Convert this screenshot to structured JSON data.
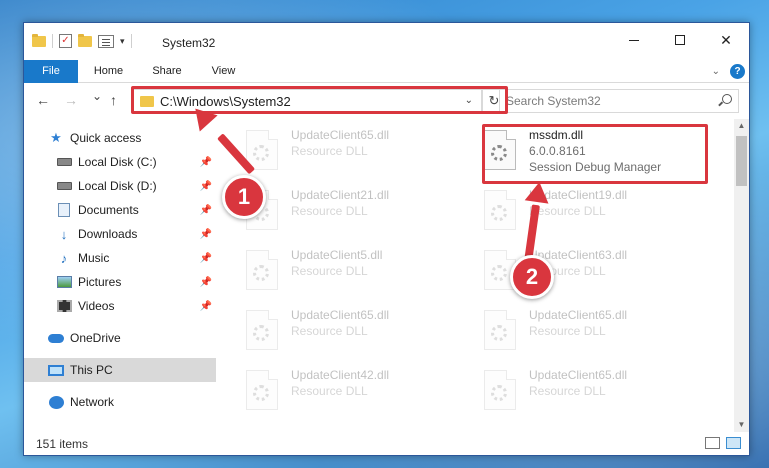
{
  "window": {
    "title": "System32"
  },
  "ribbon": {
    "tabs": [
      "File",
      "Home",
      "Share",
      "View"
    ],
    "help": "?"
  },
  "nav": {
    "back": "←",
    "forward": "→",
    "recent": "⌄",
    "up": "↑",
    "address": "C:\\Windows\\System32",
    "search_placeholder": "Search System32"
  },
  "sidebar": {
    "items": [
      {
        "label": "Quick access",
        "icon": "star-icon"
      },
      {
        "label": "Local Disk (C:)",
        "icon": "disk-icon",
        "pinned": true
      },
      {
        "label": "Local Disk (D:)",
        "icon": "disk-icon",
        "pinned": true
      },
      {
        "label": "Documents",
        "icon": "documents-icon",
        "pinned": true
      },
      {
        "label": "Downloads",
        "icon": "downloads-icon",
        "pinned": true
      },
      {
        "label": "Music",
        "icon": "music-icon",
        "pinned": true
      },
      {
        "label": "Pictures",
        "icon": "pictures-icon",
        "pinned": true
      },
      {
        "label": "Videos",
        "icon": "videos-icon",
        "pinned": true
      },
      {
        "label": "OneDrive",
        "icon": "onedrive-icon"
      },
      {
        "label": "This PC",
        "icon": "this-pc-icon",
        "selected": true
      },
      {
        "label": "Network",
        "icon": "network-icon"
      }
    ]
  },
  "files": [
    {
      "name": "UpdateClient65.dll",
      "type": "Resource DLL"
    },
    {
      "name": "mssdm.dll",
      "version": "6.0.0.8161",
      "description": "Session Debug Manager",
      "highlighted": true
    },
    {
      "name": "UpdateClient21.dll",
      "type": "Resource DLL"
    },
    {
      "name": "UpdateClient19.dll",
      "type": "Resource DLL"
    },
    {
      "name": "UpdateClient5.dll",
      "type": "Resource DLL"
    },
    {
      "name": "UpdateClient63.dll",
      "type": "Resource DLL"
    },
    {
      "name": "UpdateClient65.dll",
      "type": "Resource DLL"
    },
    {
      "name": "UpdateClient65.dll",
      "type": "Resource DLL"
    },
    {
      "name": "UpdateClient42.dll",
      "type": "Resource DLL"
    },
    {
      "name": "UpdateClient65.dll",
      "type": "Resource DLL"
    }
  ],
  "status": {
    "items_count": "151 items"
  },
  "callouts": {
    "step1": "1",
    "step2": "2",
    "color": "#d9363e"
  }
}
